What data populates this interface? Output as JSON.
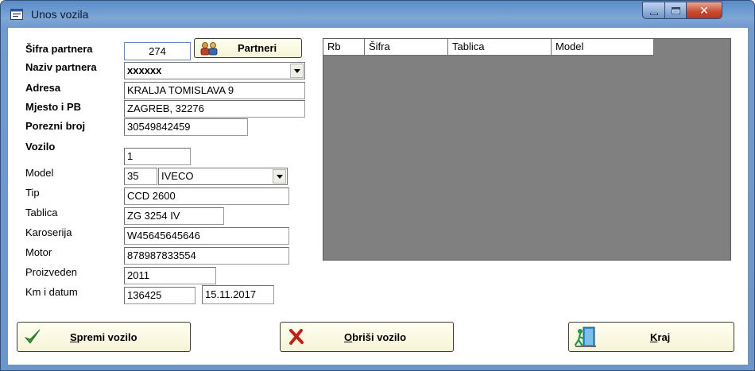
{
  "window": {
    "title": "Unos vozila",
    "min_icon": "minimize-icon",
    "max_icon": "maximize-icon",
    "close_symbol": "✕"
  },
  "partner": {
    "sifra_label": "Šifra partnera",
    "sifra_value": "274",
    "partneri_button": "Partneri",
    "naziv_label": "Naziv partnera",
    "naziv_value": "xxxxxx",
    "adresa_label": "Adresa",
    "adresa_value": "KRALJA TOMISLAVA 9",
    "mjesto_label": "Mjesto i PB",
    "mjesto_value": "ZAGREB, 32276",
    "porezni_label": "Porezni broj",
    "porezni_value": "30549842459"
  },
  "vehicle": {
    "vozilo_label": "Vozilo",
    "vozilo_value": "1",
    "model_label": "Model",
    "model_code": "35",
    "model_name": "IVECO",
    "tip_label": "Tip",
    "tip_value": "CCD 2600",
    "tablica_label": "Tablica",
    "tablica_value": "ZG 3254 IV",
    "karoserija_label": "Karoserija",
    "karoserija_value": "W45645645646",
    "motor_label": "Motor",
    "motor_value": "878987833554",
    "proizveden_label": "Proizveden",
    "proizveden_value": "2011",
    "km_label": "Km i datum",
    "km_value": "136425",
    "datum_value": "15.11.2017"
  },
  "grid": {
    "columns": [
      "Rb",
      "Šifra",
      "Tablica",
      "Model"
    ]
  },
  "buttons": {
    "spremi_u": "S",
    "spremi_rest": "premi vozilo",
    "obrisi_u": "O",
    "obrisi_rest": "briši vozilo",
    "kraj_u": "K",
    "kraj_rest": "raj"
  },
  "colors": {
    "button_face": "#f5f3d6",
    "grid_background": "#808080",
    "check_green": "#2e9a2e",
    "delete_red": "#c0201a"
  }
}
